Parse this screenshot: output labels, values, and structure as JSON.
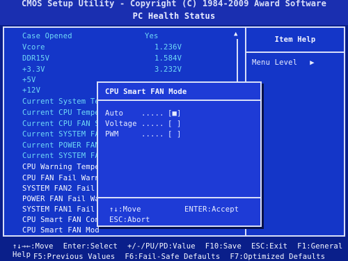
{
  "header": {
    "line1": "CMOS Setup Utility - Copyright (C) 1984-2009 Award Software",
    "line2": "PC Health Status"
  },
  "help_panel": {
    "title": "Item Help",
    "menu_level": "Menu Level",
    "menu_arrow": "▶"
  },
  "rows": [
    {
      "label": "Case Opened",
      "value": "Yes"
    },
    {
      "label": "Vcore",
      "value": "1.236V"
    },
    {
      "label": "DDR15V",
      "value": "1.584V"
    },
    {
      "label": "+3.3V",
      "value": "3.232V"
    },
    {
      "label": "+5V",
      "value": ""
    },
    {
      "label": "+12V",
      "value": ""
    },
    {
      "label": "Current System Te",
      "value": ""
    },
    {
      "label": "Current CPU Tempe",
      "value": ""
    },
    {
      "label": "Current CPU FAN S",
      "value": ""
    },
    {
      "label": "Current SYSTEM FA",
      "value": ""
    },
    {
      "label": "Current POWER FAN",
      "value": ""
    },
    {
      "label": "Current SYSTEM FA",
      "value": ""
    },
    {
      "label": "CPU Warning Tempe",
      "value": ""
    },
    {
      "label": "CPU FAN Fail Warn",
      "value": ""
    },
    {
      "label": "SYSTEM FAN2 Fail",
      "value": ""
    },
    {
      "label": "POWER FAN Fail Wa",
      "value": ""
    },
    {
      "label": "SYSTEM FAN1 Fail",
      "value": ""
    },
    {
      "label": "CPU Smart FAN Con",
      "value": ""
    },
    {
      "label": "CPU Smart FAN Mod",
      "value": ""
    }
  ],
  "scroll": {
    "up": "▲",
    "down": "▼"
  },
  "popup": {
    "title": "CPU Smart FAN Mode",
    "options": [
      {
        "label": "Auto",
        "dots": ".....",
        "box": "[■]"
      },
      {
        "label": "Voltage",
        "dots": ".....",
        "box": "[ ]"
      },
      {
        "label": "PWM",
        "dots": ".....",
        "box": "[ ]"
      }
    ],
    "key_move": "↑↓:Move",
    "key_accept": "ENTER:Accept",
    "key_abort": "ESC:Abort"
  },
  "bottom": {
    "line1": [
      "↑↓→←:Move",
      "Enter:Select",
      "+/-/PU/PD:Value",
      "F10:Save",
      "ESC:Exit",
      "F1:General Help"
    ],
    "line2": [
      "F5:Previous Values",
      "F6:Fail-Safe Defaults",
      "F7:Optimized Defaults"
    ]
  },
  "colors": {
    "background": "#0a1f8a",
    "panel": "#1436c8",
    "label_cyan": "#6fd8f6",
    "label_white": "#f4f6ff"
  }
}
